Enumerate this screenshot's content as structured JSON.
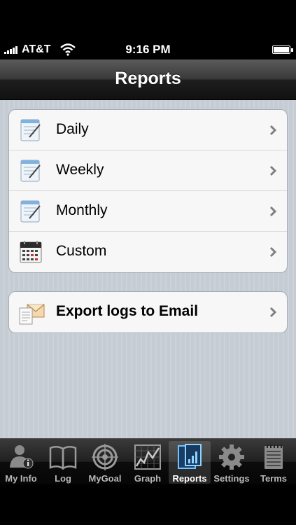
{
  "status_bar": {
    "carrier": "AT&T",
    "time": "9:16 PM",
    "icons": [
      "signal-icon",
      "wifi-icon",
      "battery-icon"
    ]
  },
  "nav": {
    "title": "Reports"
  },
  "reports": [
    {
      "label": "Daily",
      "icon": "notepad-icon"
    },
    {
      "label": "Weekly",
      "icon": "notepad-icon"
    },
    {
      "label": "Monthly",
      "icon": "notepad-icon"
    },
    {
      "label": "Custom",
      "icon": "calendar-icon"
    }
  ],
  "export": {
    "label": "Export logs to Email",
    "icon": "mail-icon"
  },
  "tabs": [
    {
      "label": "My Info",
      "icon": "person-info-icon"
    },
    {
      "label": "Log",
      "icon": "book-icon"
    },
    {
      "label": "MyGoal",
      "icon": "target-icon"
    },
    {
      "label": "Graph",
      "icon": "graph-icon"
    },
    {
      "label": "Reports",
      "icon": "reports-icon",
      "selected": true
    },
    {
      "label": "Settings",
      "icon": "gear-icon"
    },
    {
      "label": "Terms",
      "icon": "notepad-icon"
    }
  ],
  "colors": {
    "background": "#c5ccd4",
    "tab_selected_label": "#ffffff",
    "tab_label": "#b8b8b8",
    "chevron": "#7f7f7f"
  }
}
